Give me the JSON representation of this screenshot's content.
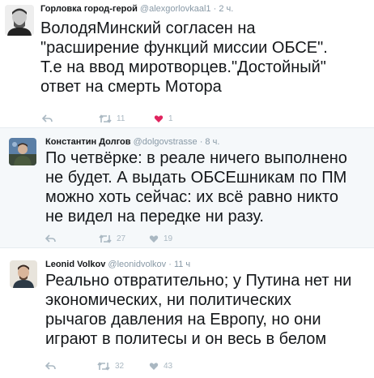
{
  "tweets": [
    {
      "name": "Горловка город-герой",
      "handle": "@alexgorlovkaal1",
      "time": "2 ч.",
      "lines": [
        "ВолодяМинский согласен на",
        "\"расширение функций миссии ОБСЕ\".",
        "Т.е на ввод миротворцев.\"Достойный\"",
        "ответ на смерть Мотора"
      ],
      "retweets": "11",
      "likes": "1"
    },
    {
      "name": "Константин Долгов",
      "handle": "@dolgovstrasse",
      "time": "8 ч.",
      "lines": [
        "По четвёрке: в реале ничего выполнено",
        "не будет. А выдать ОБСЕшникам по ПМ",
        "можно хоть сейчас: их всё равно никто",
        "не видел на передке ни разу."
      ],
      "retweets": "27",
      "likes": "19"
    },
    {
      "name": "Leonid Volkov",
      "handle": "@leonidvolkov",
      "time": "11 ч",
      "lines": [
        "Реально отвратительно; у Путина нет ни",
        "экономических, ни политических",
        "рычагов давления на Европу, но они",
        "играют в политесы и он весь в белом"
      ],
      "retweets": "32",
      "likes": "43"
    }
  ],
  "separator": "·",
  "colors": {
    "like": "#e0245e",
    "icon": "#aab8c2",
    "meta": "#8899a6"
  }
}
